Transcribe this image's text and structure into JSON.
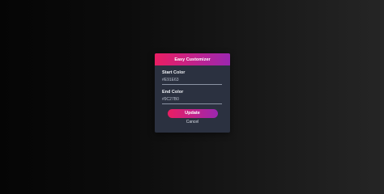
{
  "colors": {
    "start": "#E91E63",
    "end": "#9C27B0",
    "modal_background": "#2b3140"
  },
  "modal": {
    "title": "Easy Customizer",
    "start_label": "Start Color",
    "start_value": "#E91E63",
    "end_label": "End Color",
    "end_value": "#9C27B0",
    "update_label": "Update",
    "cancel_label": "Cancel"
  }
}
